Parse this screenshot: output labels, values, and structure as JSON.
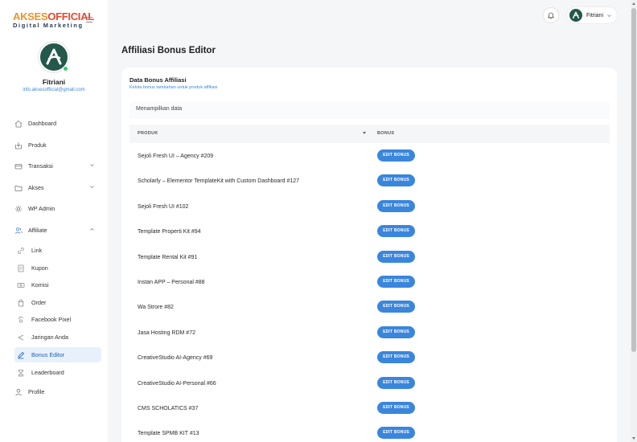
{
  "brand": {
    "logo_part1": "AKSES",
    "logo_part2": "OFFICIAL",
    "tagline": "Digital Marketing"
  },
  "profile": {
    "name": "Fitriani",
    "email": "info.aksesofficial@gmail.com"
  },
  "sidebar": {
    "items": [
      {
        "label": "Dashboard",
        "icon": "home-icon"
      },
      {
        "label": "Produk",
        "icon": "box-icon"
      },
      {
        "label": "Transaksi",
        "icon": "wallet-icon"
      },
      {
        "label": "Akses",
        "icon": "folder-icon"
      },
      {
        "label": "WP Admin",
        "icon": "gear-icon"
      },
      {
        "label": "Affiliate",
        "icon": "users-icon"
      },
      {
        "label": "Link",
        "icon": "link-icon"
      },
      {
        "label": "Kupon",
        "icon": "ticket-icon"
      },
      {
        "label": "Komisi",
        "icon": "money-icon"
      },
      {
        "label": "Order",
        "icon": "bag-icon"
      },
      {
        "label": "Facebook Pixel",
        "icon": "pixel-icon"
      },
      {
        "label": "Jaringan Anda",
        "icon": "share-icon"
      },
      {
        "label": "Bonus Editor",
        "icon": "edit-icon"
      },
      {
        "label": "Leaderboard",
        "icon": "trophy-icon"
      },
      {
        "label": "Profile",
        "icon": "user-icon"
      }
    ]
  },
  "topbar": {
    "user_name": "Fitriani"
  },
  "main": {
    "page_title": "Affiliasi Bonus Editor",
    "card_title": "Data Bonus Affiliasi",
    "card_subtitle": "Kelola bonus tambahan untuk produk affiliasi",
    "info_text": "Menampilkan data",
    "columns": [
      "PRODUK",
      "BONUS"
    ],
    "button_label": "EDIT BONUS",
    "rows": [
      "Sejoli Fresh UI – Agency #209",
      "Scholarly – Elementor TemplateKit with Custom Dashboard #127",
      "Sejoli Fresh UI #102",
      "Template Properti Kit #94",
      "Template Rental Kit #91",
      "Instan APP – Personal #88",
      "Wa Strore #82",
      "Jasa Hosting RDM #72",
      "CreativeStudio AI-Agency #69",
      "CreativeStudio AI-Personal #66",
      "CMS SCHOLATICS #37",
      "Template SPMB KIT #13"
    ]
  },
  "colors": {
    "accent": "#3a86dc",
    "active_bg": "#e8f1fb",
    "brand_orange": "#f0922b",
    "brand_red": "#e6472e",
    "avatar_green": "#24584a"
  }
}
